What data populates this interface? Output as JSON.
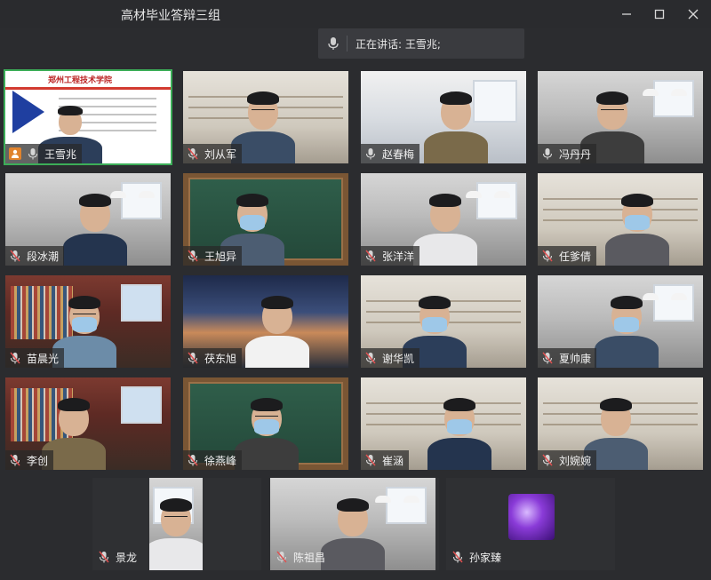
{
  "window": {
    "title": "高材毕业答辩三组",
    "speaking_label": "正在讲话: 王雪兆;"
  },
  "participants": [
    {
      "name": "王雪兆",
      "role": "host",
      "mic": "host",
      "bg": "slide",
      "active": true
    },
    {
      "name": "刘从军",
      "role": "participant",
      "mic": "muted",
      "bg": "shelf"
    },
    {
      "name": "赵春梅",
      "role": "participant",
      "mic": "on",
      "bg": "room"
    },
    {
      "name": "冯丹丹",
      "role": "participant",
      "mic": "on",
      "bg": "office"
    },
    {
      "name": "段冰潮",
      "role": "participant",
      "mic": "muted",
      "bg": "office"
    },
    {
      "name": "王旭异",
      "role": "participant",
      "mic": "muted",
      "bg": "chalk"
    },
    {
      "name": "张洋洋",
      "role": "participant",
      "mic": "muted",
      "bg": "office"
    },
    {
      "name": "任爹倩",
      "role": "participant",
      "mic": "muted",
      "bg": "shelf"
    },
    {
      "name": "苗晨光",
      "role": "participant",
      "mic": "muted",
      "bg": "brick"
    },
    {
      "name": "茯东旭",
      "role": "participant",
      "mic": "muted",
      "bg": "city"
    },
    {
      "name": "谢华凯",
      "role": "participant",
      "mic": "muted",
      "bg": "shelf"
    },
    {
      "name": "夏帅康",
      "role": "participant",
      "mic": "muted",
      "bg": "office"
    },
    {
      "name": "李创",
      "role": "participant",
      "mic": "muted",
      "bg": "brick"
    },
    {
      "name": "徐燕峰",
      "role": "participant",
      "mic": "muted",
      "bg": "chalk"
    },
    {
      "name": "崔涵",
      "role": "participant",
      "mic": "muted",
      "bg": "shelf"
    },
    {
      "name": "刘婉婉",
      "role": "participant",
      "mic": "muted",
      "bg": "shelf"
    },
    {
      "name": "景龙",
      "role": "participant",
      "mic": "muted",
      "bg": "office"
    },
    {
      "name": "陈祖昌",
      "role": "participant",
      "mic": "muted",
      "bg": "office"
    },
    {
      "name": "孙家臻",
      "role": "participant",
      "mic": "muted",
      "bg": "avatar"
    }
  ],
  "slide": {
    "school_name": "郑州工程技术学院"
  },
  "colors": {
    "active_border": "#3cae58",
    "host_badge": "#e0832d",
    "muted_icon": "#e05050"
  },
  "icons": {
    "minimize": "minimize-icon",
    "maximize": "maximize-icon",
    "close": "close-icon",
    "mic": "microphone-icon",
    "mic_muted": "microphone-muted-icon",
    "host": "host-user-icon"
  }
}
